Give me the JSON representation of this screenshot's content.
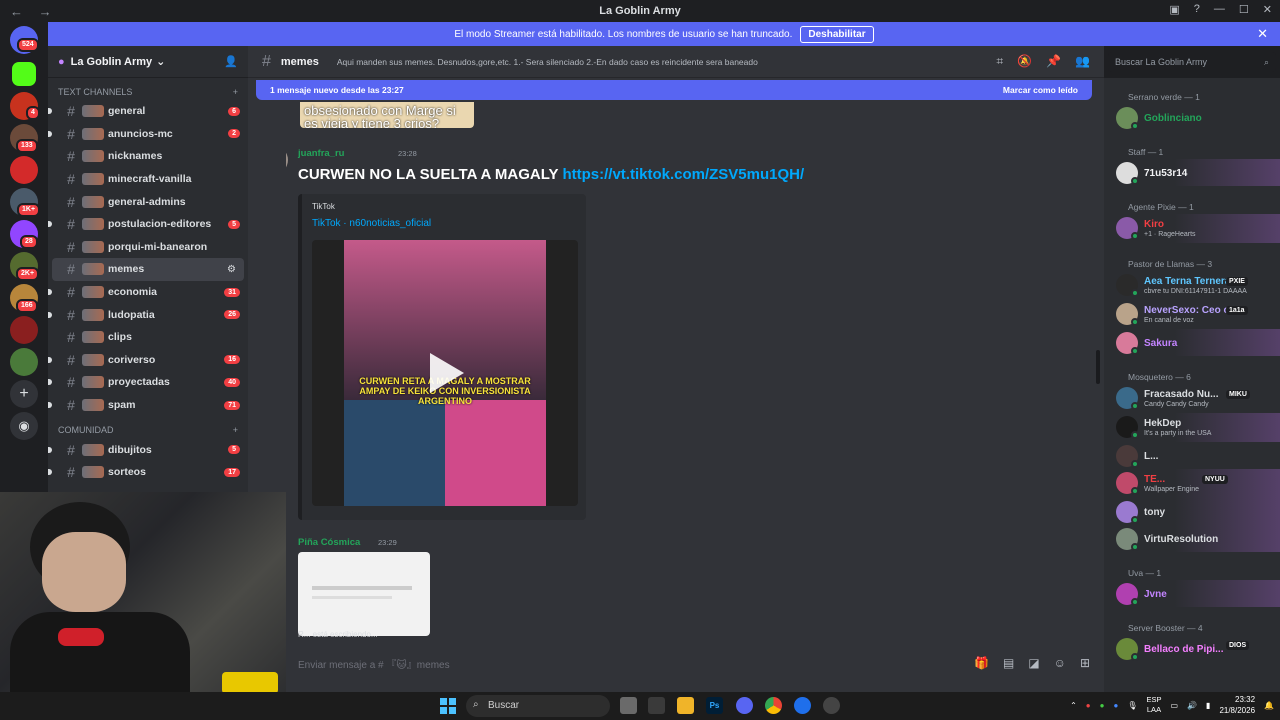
{
  "window": {
    "title": "La Goblin Army",
    "nav": "← →"
  },
  "banner": {
    "text": "El modo Streamer está habilitado. Los nombres de usuario se han truncado.",
    "button": "Deshabilitar"
  },
  "rail": {
    "badges": [
      "524",
      "4",
      "133",
      "1K+",
      "28",
      "2K+",
      "166"
    ]
  },
  "guild": {
    "name": "La Goblin Army"
  },
  "categories": {
    "text": "Text Channels",
    "community": "COMUNIDAD"
  },
  "channels": [
    {
      "name": "general",
      "count": "6"
    },
    {
      "name": "anuncios-mc",
      "count": "2"
    },
    {
      "name": "nicknames",
      "count": ""
    },
    {
      "name": "minecraft-vanilla",
      "count": ""
    },
    {
      "name": "general-admins",
      "count": ""
    },
    {
      "name": "postulacion-editores",
      "count": "5"
    },
    {
      "name": "porqui-mi-banearon",
      "count": ""
    },
    {
      "name": "memes",
      "count": ""
    },
    {
      "name": "economia",
      "count": "31"
    },
    {
      "name": "ludopatia",
      "count": "26"
    },
    {
      "name": "clips",
      "count": ""
    },
    {
      "name": "coriverso",
      "count": "16"
    },
    {
      "name": "proyectadas",
      "count": "40"
    },
    {
      "name": "spam",
      "count": "71"
    }
  ],
  "community_channels": [
    {
      "name": "dibujitos",
      "count": "5"
    },
    {
      "name": "sorteos",
      "count": "17"
    }
  ],
  "chat": {
    "channel_name": "memes",
    "topic": "Aqui manden sus memes. Desnudos,gore,etc. 1.- Sera silenciado 2.-En dado caso es reincidente sera baneado",
    "search_placeholder": "Buscar La Goblin Army",
    "new_messages": "1 mensaje nuevo desde las 23:27",
    "mark_read": "Marcar como leído",
    "prev_bubble": "obsesionado con Marge si es vieja y tiene 3 crios?",
    "msg1": {
      "author": "juanfra_ru",
      "time": "23:28",
      "text": "CURWEN NO LA SUELTA A MAGALY ",
      "link": "https://vt.tiktok.com/ZSV5mu1QH/",
      "embed_provider": "TikTok",
      "embed_author": "TikTok · n60noticias_oficial",
      "video_caption": "CURWEN RETA A MAGALY A MOSTRAR AMPAY DE KEIKO CON INVERSIONISTA ARGENTINO"
    },
    "msg2": {
      "author": "Piña Cósmica",
      "time": "23:29"
    },
    "typing": "R... está escribiendo...",
    "composer_placeholder": "Enviar mensaje a # 『🐱』memes"
  },
  "members": [
    {
      "role": "Serrano verde — 1",
      "items": [
        {
          "name": "Goblinciano",
          "sub": "",
          "color": "#23a55a"
        }
      ]
    },
    {
      "role": "Staff — 1",
      "items": [
        {
          "name": "71u53r14",
          "sub": "",
          "color": "#f2f3f5"
        }
      ]
    },
    {
      "role": "Agente Pixie — 1",
      "items": [
        {
          "name": "Kiro",
          "sub": "+1 · RageHearts",
          "color": "#f23f43"
        }
      ]
    },
    {
      "role": "Pastor de Llamas — 3",
      "items": [
        {
          "name": "Aea Terna Ternera",
          "sub": "cbvre tu DNI:61147911-1 DAAAA",
          "color": "#5fc7ff"
        },
        {
          "name": "NeverSexo: Ceo o...",
          "sub": "En canal de voz",
          "color": "#b9a3ff"
        },
        {
          "name": "Sakura",
          "sub": "",
          "color": "#c384ff"
        }
      ]
    },
    {
      "role": "Mosquetero — 6",
      "items": [
        {
          "name": "Fracasado Nu...",
          "sub": "Candy Candy Candy",
          "color": "#dbdee1"
        },
        {
          "name": "HekDep",
          "sub": "It's a party in the USA",
          "color": "#dbdee1"
        },
        {
          "name": "L...",
          "sub": "",
          "color": "#dbdee1"
        },
        {
          "name": "TE...",
          "sub": "Wallpaper Engine",
          "color": "#f23f43"
        },
        {
          "name": "tony",
          "sub": "",
          "color": "#dbdee1"
        },
        {
          "name": "VirtuResolution",
          "sub": "",
          "color": "#dbdee1"
        }
      ]
    },
    {
      "role": "Uva — 1",
      "items": [
        {
          "name": "Jvne",
          "sub": "",
          "color": "#c384ff"
        }
      ]
    },
    {
      "role": "Server Booster — 4",
      "items": [
        {
          "name": "Bellaco de Pipi...",
          "sub": "",
          "color": "#f47fff"
        }
      ]
    }
  ],
  "member_tags": {
    "aea": "PXIE",
    "never": "1a1a",
    "fracasado": "MIKU",
    "te": "NYUU",
    "bellaco": "DIOS"
  },
  "taskbar": {
    "search": "Buscar",
    "lang1": "ESP",
    "lang2": "LAA",
    "time": "23:32",
    "date": "21/8/2026"
  }
}
